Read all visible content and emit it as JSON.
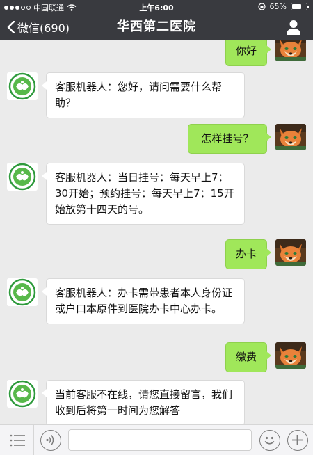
{
  "status_bar": {
    "carrier": "中国联通",
    "time": "上午6:00",
    "battery": "65%",
    "battery_level": 0.65
  },
  "nav": {
    "back_label": "微信(690)",
    "title": "华西第二医院",
    "profile_icon": "person-icon"
  },
  "messages": [
    {
      "from": "user",
      "text": "你好"
    },
    {
      "from": "bot",
      "text": "客服机器人：您好，请问需要什么帮助？"
    },
    {
      "from": "user",
      "text": "怎样挂号？"
    },
    {
      "from": "bot",
      "text": "客服机器人：当日挂号：每天早上7：30开始；预约挂号：每天早上7：15开始放第十四天的号。"
    },
    {
      "from": "user",
      "text": "办卡"
    },
    {
      "from": "bot",
      "text": "客服机器人：办卡需带患者本人身份证或户口本原件到医院办卡中心办卡。"
    },
    {
      "from": "user",
      "text": "缴费"
    },
    {
      "from": "bot",
      "text": "当前客服不在线，请您直接留言，我们收到后将第一时间为您解答"
    }
  ],
  "input_bar": {
    "menu_icon": "menu-icon",
    "voice_icon": "voice-icon",
    "text_value": "",
    "emoji_icon": "emoji-icon",
    "plus_icon": "plus-icon"
  },
  "colors": {
    "bar": "#393a3f",
    "chat_bg": "#ebebeb",
    "user_bubble": "#a0e75a",
    "bot_bubble": "#ffffff"
  }
}
